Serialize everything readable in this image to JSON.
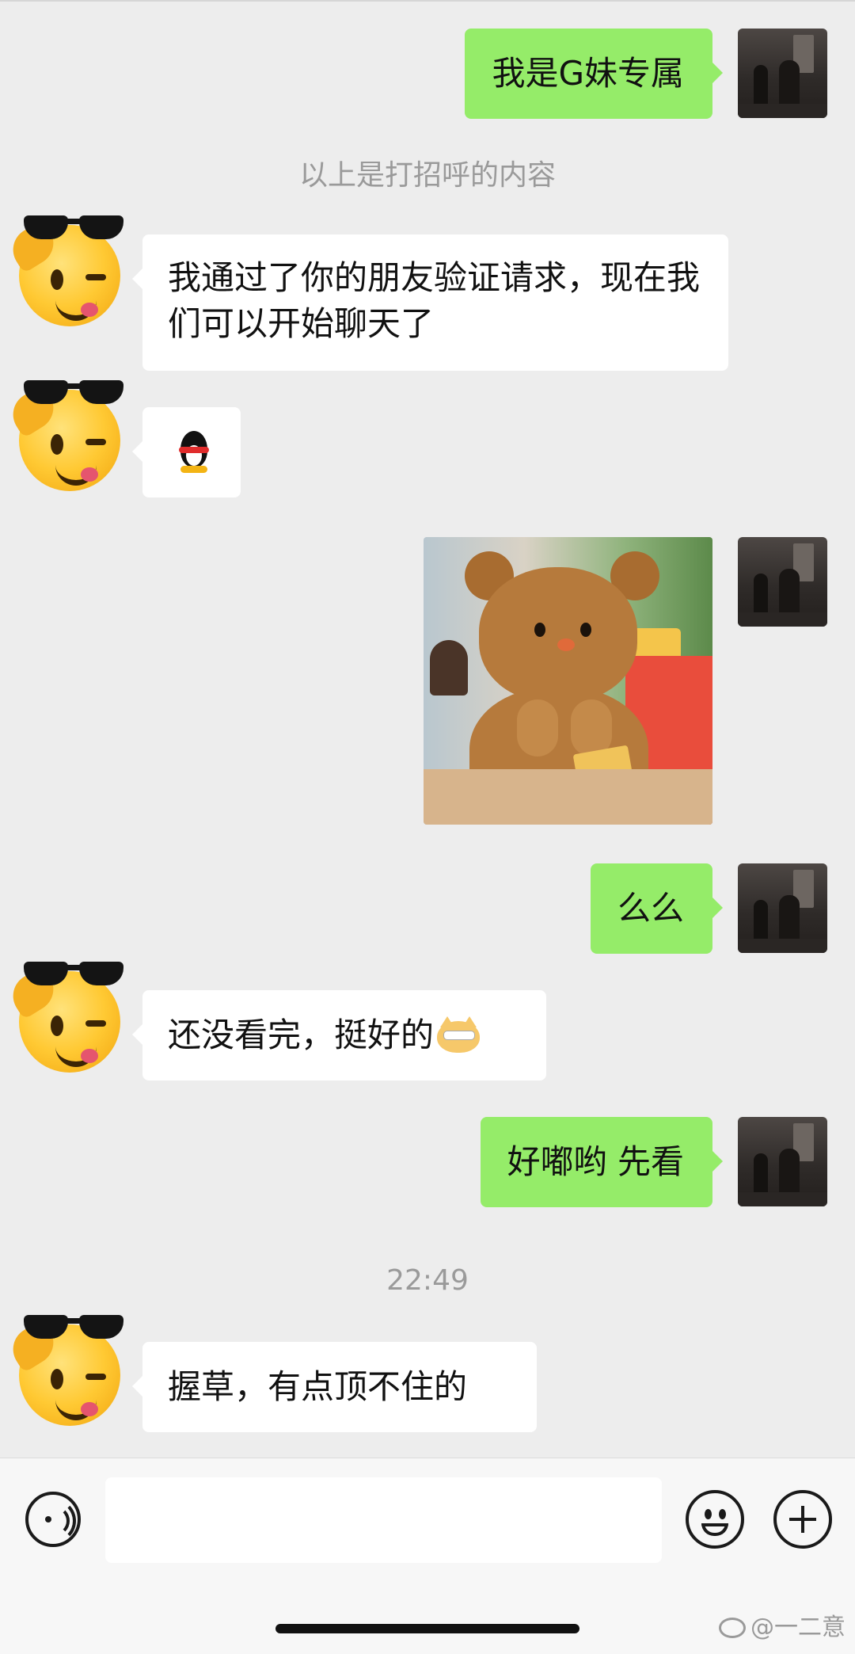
{
  "messages": {
    "m1": "我是G妹专属",
    "system_note": "以上是打招呼的内容",
    "m2": "我通过了你的朋友验证请求，现在我们可以开始聊天了",
    "m5": "么么",
    "m6": "还没看完，挺好的",
    "m7": "好嘟哟 先看",
    "timestamp": "22:49",
    "m8": "握草，有点顶不住的"
  },
  "icons": {
    "voice": "voice-icon",
    "emoji": "emoji-icon",
    "more": "plus-icon",
    "sticker_penguin": "qq-penguin-emoji",
    "cat_emoji": "cat-face-emoji"
  },
  "colors": {
    "background": "#ededed",
    "self_bubble": "#95ec69",
    "friend_bubble": "#ffffff",
    "meta_text": "#9a9a9a"
  },
  "watermark": {
    "text": "@一二意"
  }
}
